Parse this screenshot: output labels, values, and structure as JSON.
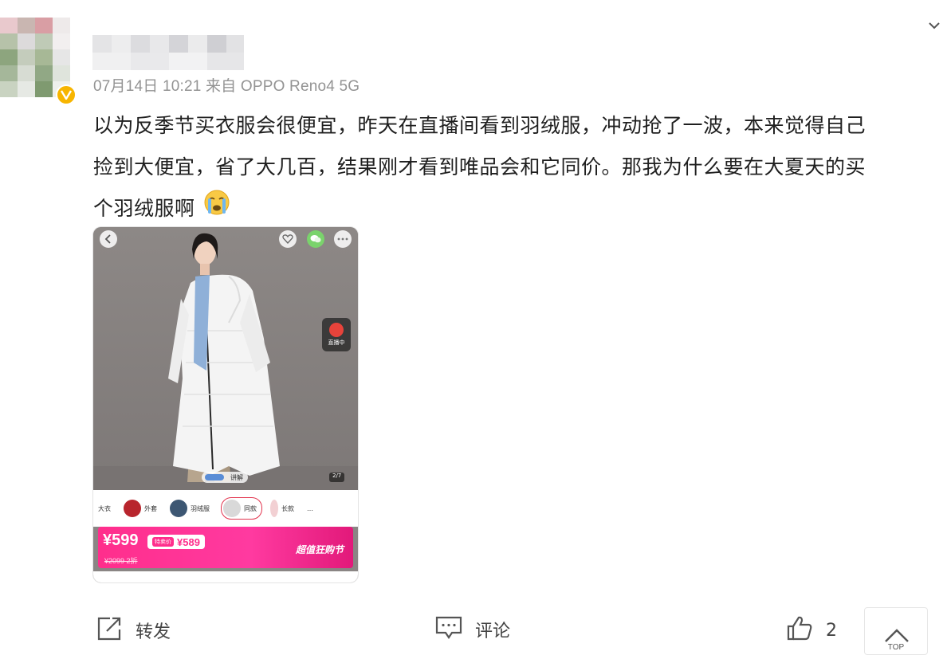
{
  "post": {
    "meta": "07月14日 10:21  来自 OPPO Reno4 5G",
    "lines": [
      "以为反季节买衣服会很便宜，昨天在直播间看到羽绒服，冲动抢了一波，本来觉得自己",
      "捡到大便宜，省了大几百，结果刚才看到唯品会和它同价。那我为什么要在大夏天的买",
      "个羽绒服啊"
    ],
    "emoji_icon": "crying-face-icon"
  },
  "product_screenshot": {
    "side_badge": "直播中",
    "image_counter": "2/7",
    "pill_label": "讲解",
    "thumbs": [
      "大衣",
      "外套",
      "羽绒服",
      "同款",
      "长款",
      "…"
    ],
    "price": "¥599",
    "tag_label": "特卖价",
    "tag_price": "¥589",
    "original_price": "¥2099  2折",
    "festival": "超值狂购节"
  },
  "actions": {
    "forward": "转发",
    "comment": "评论",
    "like_count": "2",
    "top_label": "TOP"
  },
  "colors": {
    "meta": "#939393",
    "price_pink": "#ff2e8c",
    "verified": "#f7b500"
  }
}
